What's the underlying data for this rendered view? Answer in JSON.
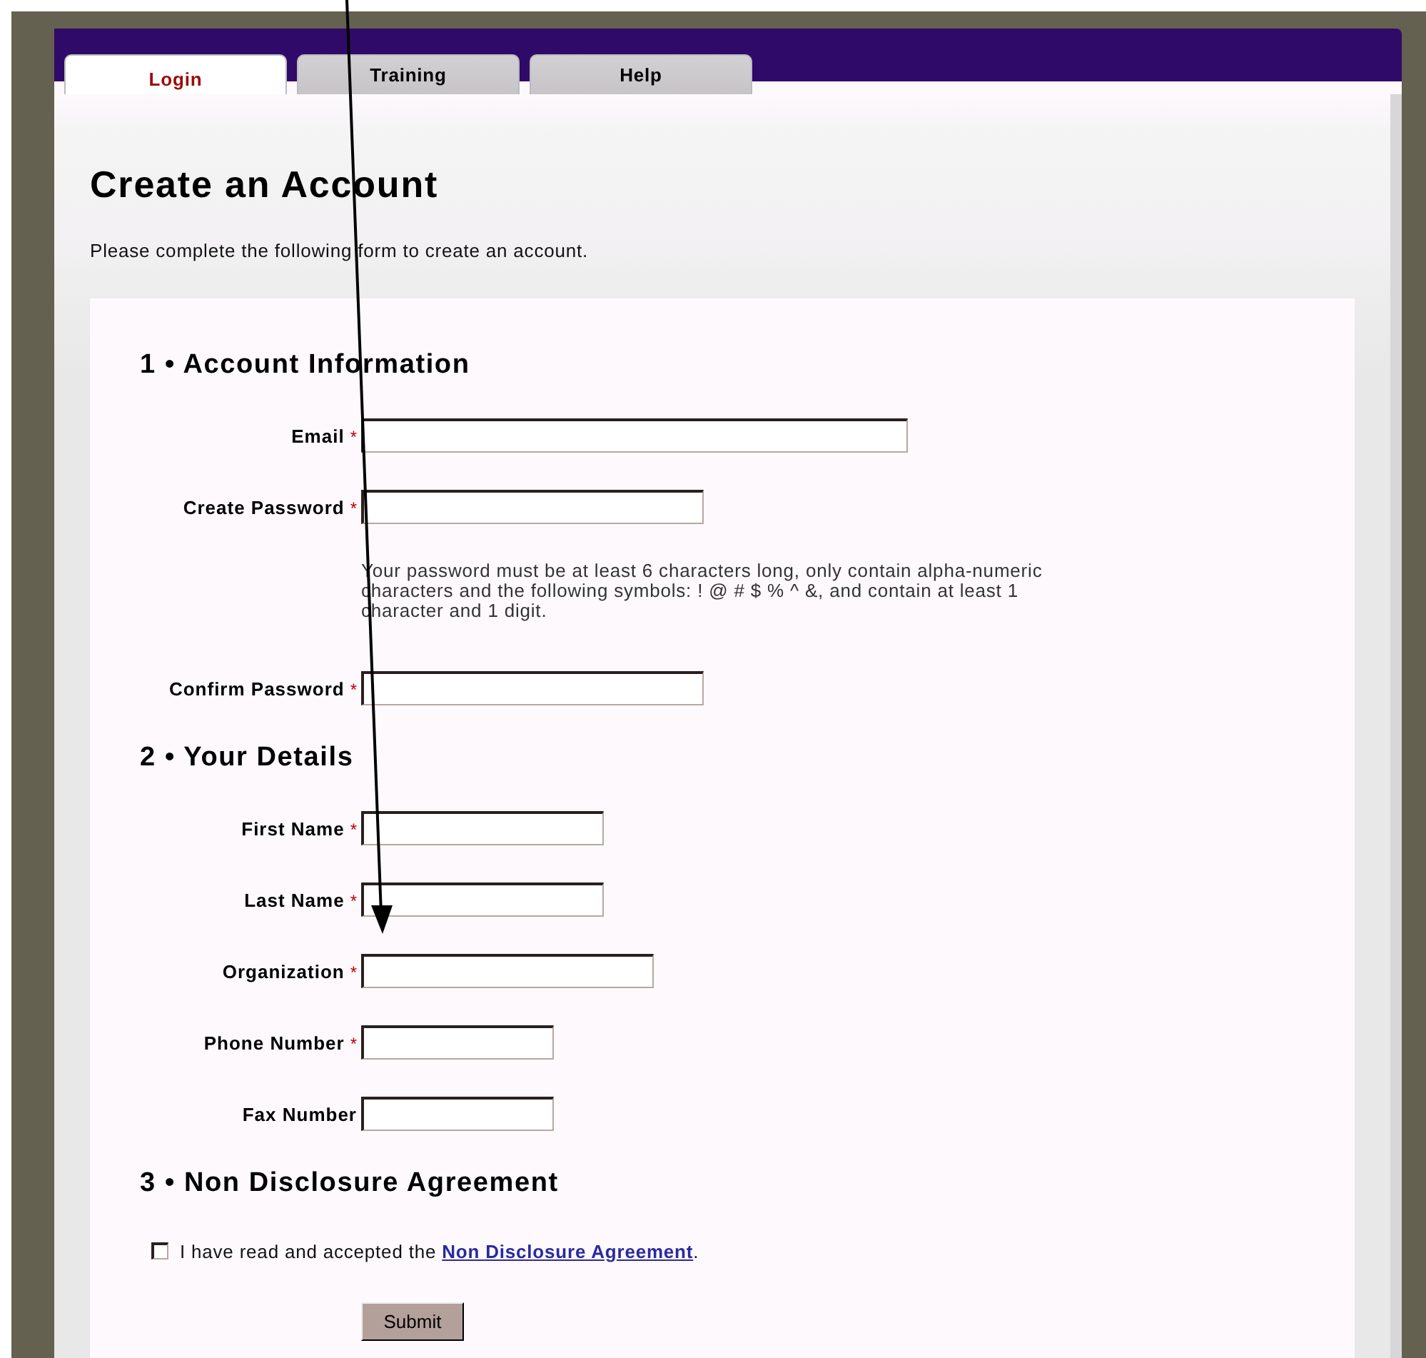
{
  "tabs": [
    {
      "label": "Login",
      "selected": true
    },
    {
      "label": "Training",
      "selected": false
    },
    {
      "label": "Help",
      "selected": false
    }
  ],
  "page": {
    "title": "Create an Account",
    "description": "Please complete the following form to create an account."
  },
  "sections": [
    {
      "heading": "1 • Account Information",
      "fields": [
        {
          "label": "Email",
          "required": true,
          "asterisk": "*"
        },
        {
          "label": "Create Password",
          "required": true,
          "asterisk": "*",
          "note": "Your password must be at least 6 characters long, only contain alpha-numeric characters and the following symbols: ! @ # $ % ^ &, and contain at least 1 character and 1 digit."
        },
        {
          "label": "Confirm Password",
          "required": true,
          "asterisk": "*"
        }
      ]
    },
    {
      "heading": "2 • Your Details",
      "fields": [
        {
          "label": "First Name",
          "required": true,
          "asterisk": "*"
        },
        {
          "label": "Last Name",
          "required": true,
          "asterisk": "*"
        },
        {
          "label": "Organization",
          "required": true,
          "asterisk": "*"
        },
        {
          "label": "Phone Number",
          "required": true,
          "asterisk": "*"
        },
        {
          "label": "Fax Number",
          "required": false
        }
      ]
    },
    {
      "heading": "3 • Non Disclosure Agreement"
    }
  ],
  "agreement": {
    "checked": false,
    "text": "I have read and accepted the",
    "link": "Non Disclosure Agreement",
    "after": "."
  },
  "submit": "Submit"
}
